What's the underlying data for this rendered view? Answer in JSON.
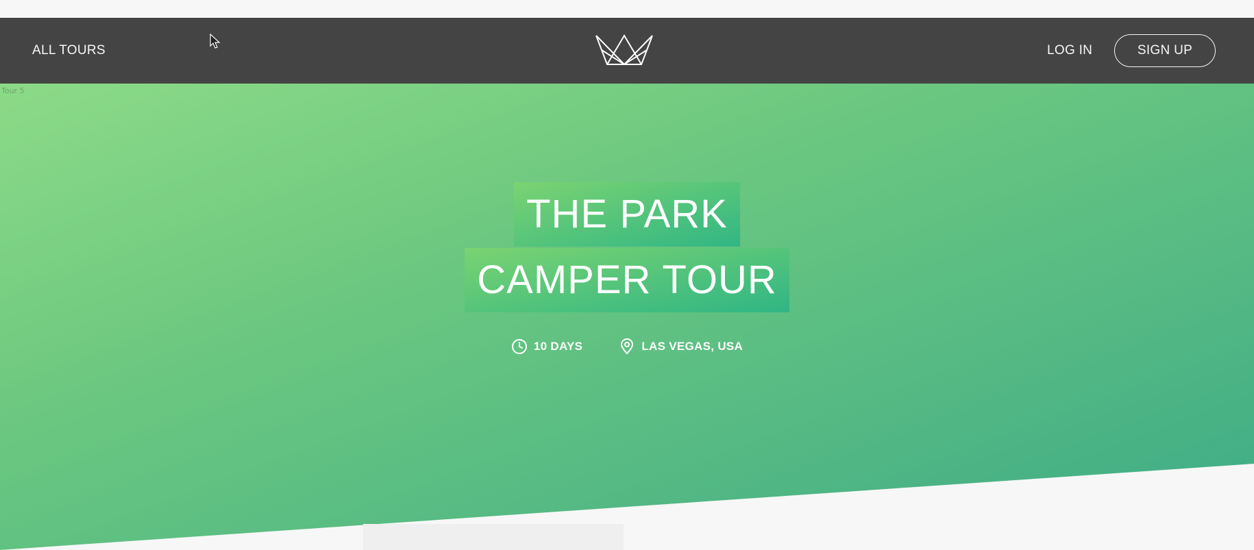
{
  "navbar": {
    "all_tours": "ALL TOURS",
    "login": "LOG IN",
    "signup": "SIGN UP",
    "logo_icon": "crown-logo-icon"
  },
  "hero": {
    "broken_image_alt": "Tour 5",
    "title_line_1": "THE PARK",
    "title_line_2": "CAMPER TOUR",
    "duration": "10 DAYS",
    "duration_icon": "clock-icon",
    "location": "LAS VEGAS, USA",
    "location_icon": "map-pin-icon"
  },
  "colors": {
    "nav_bg": "#444444",
    "hero_gradient_start": "#7dd56f",
    "hero_gradient_end": "#28b485",
    "page_bg": "#f7f7f7"
  }
}
